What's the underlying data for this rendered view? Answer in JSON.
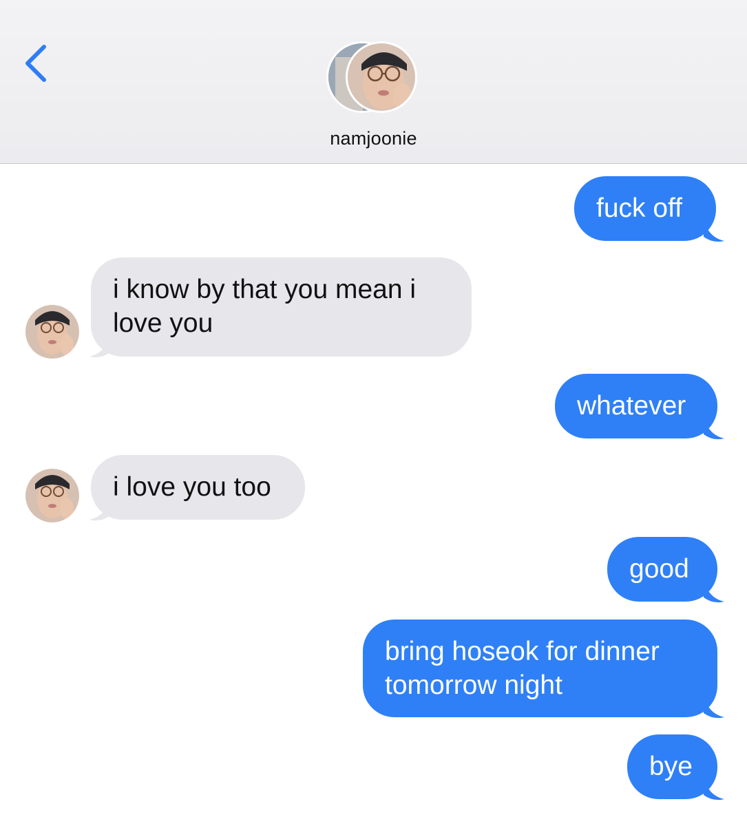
{
  "header": {
    "contact_name": "namjoonie",
    "back_icon": "chevron-left-icon"
  },
  "colors": {
    "outgoing_bubble": "#2f80f6",
    "incoming_bubble": "#e6e6eb",
    "accent": "#2f7cf6"
  },
  "messages": [
    {
      "direction": "outgoing",
      "text": "fuck off"
    },
    {
      "direction": "incoming",
      "text": "i know by that you mean i love you"
    },
    {
      "direction": "outgoing",
      "text": "whatever"
    },
    {
      "direction": "incoming",
      "text": "i love you too"
    },
    {
      "direction": "outgoing",
      "text": "good"
    },
    {
      "direction": "outgoing",
      "text": "bring hoseok for dinner tomorrow night"
    },
    {
      "direction": "outgoing",
      "text": "bye"
    }
  ]
}
